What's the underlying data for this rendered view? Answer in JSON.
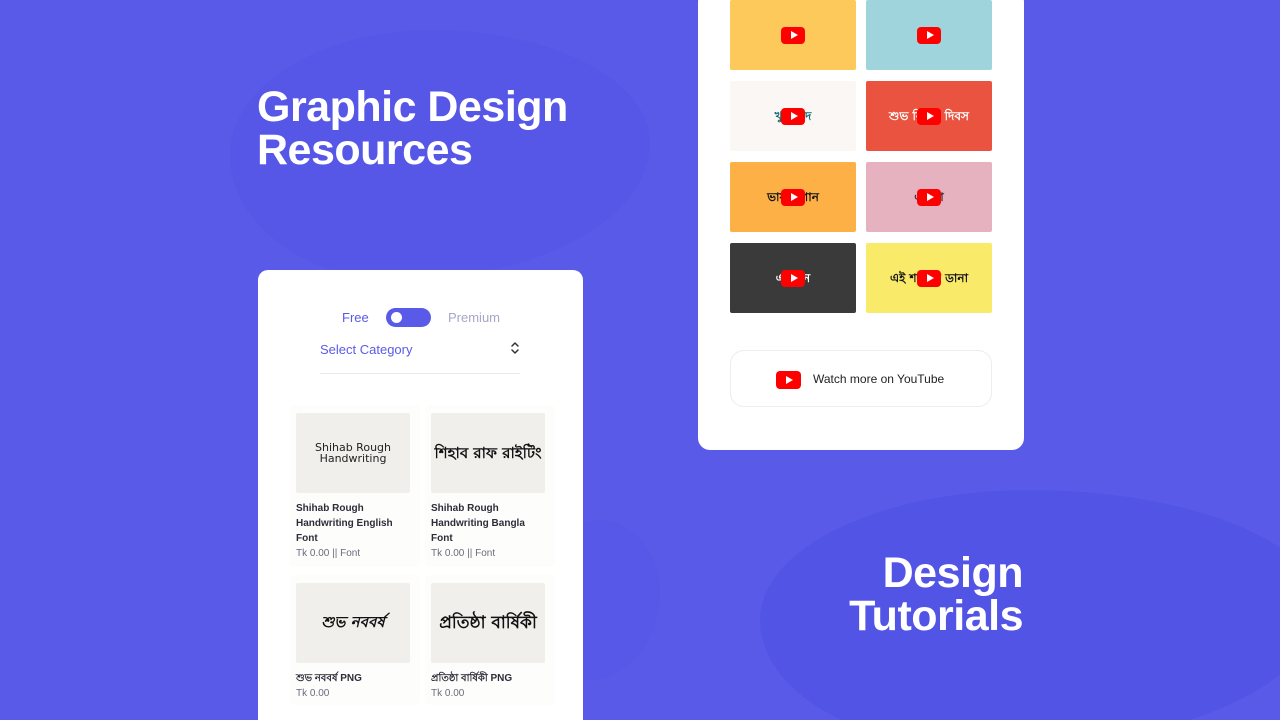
{
  "headlines": {
    "resources": [
      "Graphic Design",
      "Resources"
    ],
    "tutorials": [
      "Design",
      "Tutorials"
    ]
  },
  "resources_card": {
    "toggle": {
      "left_label": "Free",
      "right_label": "Premium"
    },
    "category_select": {
      "placeholder": "Select Category"
    },
    "products": [
      {
        "thumb_text": "Shihab Rough Handwriting",
        "title": "Shihab Rough Handwriting English Font",
        "meta": "Tk 0.00 || Font"
      },
      {
        "thumb_text": "শিহাব রাফ রাইটিং",
        "title": "Shihab Rough Handwriting Bangla Font",
        "meta": "Tk 0.00 || Font"
      },
      {
        "thumb_text": "শুভ নববর্ষ",
        "title": "শুভ নববর্ষ PNG",
        "meta": "Tk 0.00"
      },
      {
        "thumb_text": "প্রতিষ্ঠা বার্ষিকী",
        "title": "প্রতিষ্ঠা বার্ষিকী PNG",
        "meta": "Tk 0.00"
      }
    ]
  },
  "tutorials_card": {
    "videos": [
      {
        "bg": "#fcc95a",
        "fg": "#ffffff",
        "text": ""
      },
      {
        "bg": "#9fd4dc",
        "fg": "#1c1c1c",
        "text": ""
      },
      {
        "bg": "#fbf7f4",
        "fg": "#0f6d78",
        "text": "খুশি ঈদ"
      },
      {
        "bg": "#ea5340",
        "fg": "#ffffff",
        "text": "শুভ বিজয় দিবস"
      },
      {
        "bg": "#fdb046",
        "fg": "#111111",
        "text": "ভাষার গান"
      },
      {
        "bg": "#e7b2bf",
        "fg": "#2a2a2a",
        "text": "একুশে"
      },
      {
        "bg": "#3a3a3a",
        "fg": "#ffffff",
        "text": "একদিন"
      },
      {
        "bg": "#f9ea6a",
        "fg": "#111111",
        "text": "এই শহরের ডানা"
      }
    ],
    "watch_more_label": "Watch more on YouTube"
  }
}
